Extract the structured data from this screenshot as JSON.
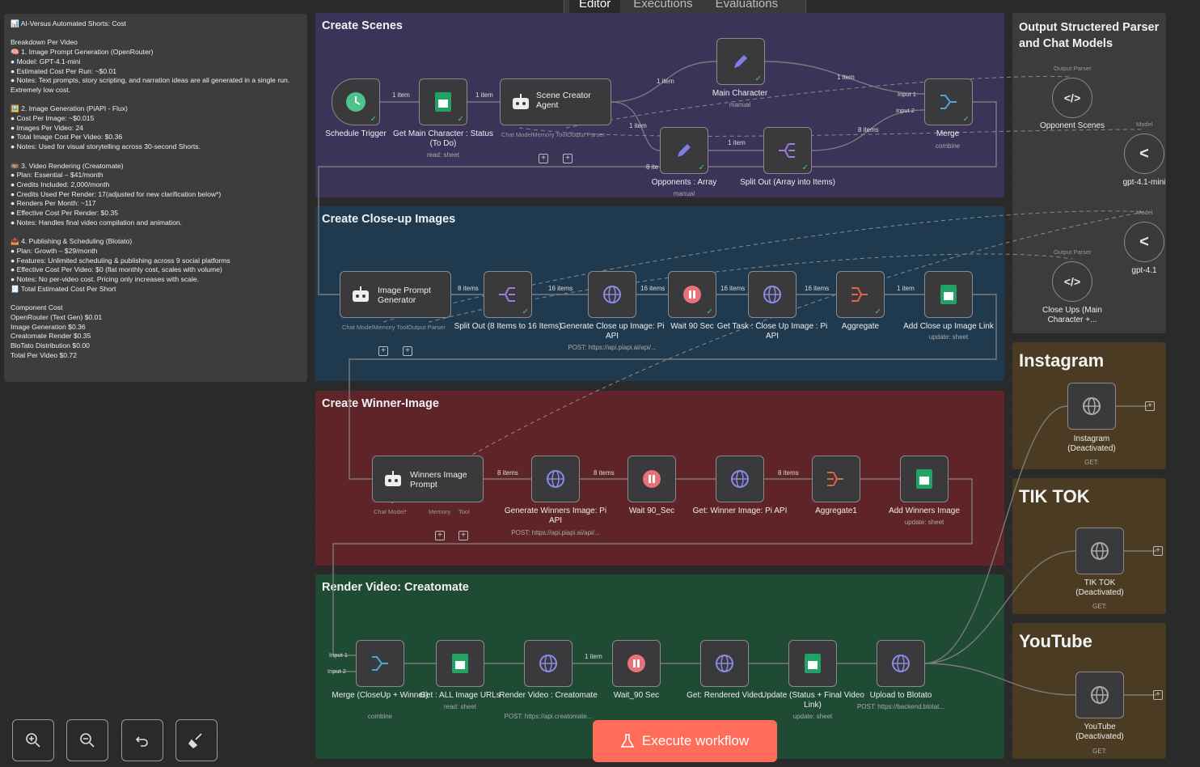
{
  "tabs": {
    "editor": "Editor",
    "executions": "Executions",
    "evaluations": "Evaluations"
  },
  "note": {
    "lines": [
      "📊 AI-Versus Automated Shorts: Cost",
      "",
      "Breakdown Per Video",
      "🧠 1. Image Prompt Generation (OpenRouter)",
      "● Model: GPT-4.1-mini",
      "● Estimated Cost Per Run: ~$0.01",
      "● Notes: Text prompts, story scripting, and narration ideas are all generated in a single run. Extremely low cost.",
      "",
      "🖼️ 2. Image Generation (PiAPI - Flux)",
      "● Cost Per Image: ~$0.015",
      "● Images Per Video: 24",
      "● Total Image Cost Per Video: $0.36",
      "● Notes: Used for visual storytelling across 30-second Shorts.",
      "",
      "🎞️ 3. Video Rendering (Creatomate)",
      "● Plan: Essential – $41/month",
      "● Credits Included: 2,000/month",
      "● Credits Used Per Render: 17(adjusted for new clarification below*)",
      "● Renders Per Month: ~117",
      "● Effective Cost Per Render: $0.35",
      "● Notes: Handles final video compilation and animation.",
      "",
      "📤 4. Publishing & Scheduling (Blotato)",
      "● Plan: Growth – $29/month",
      "● Features: Unlimited scheduling & publishing across 9 social platforms",
      "● Effective Cost Per Video: $0 (flat monthly cost, scales with volume)",
      "● Notes: No per-video cost. Pricing only increases with scale.",
      "🧾 Total Estimated Cost Per Short",
      "",
      "Component Cost",
      "OpenRouter (Text Gen) $0.01",
      "Image Generation $0.36",
      "Creatomate Render $0.35",
      "BloTato Distribution $0.00",
      "Total Per Video $0.72"
    ]
  },
  "sections": {
    "scenes": "Create Scenes",
    "closeup": "Create Close-up Images",
    "winner": "Create Winner-Image",
    "render": "Render Video: Creatomate",
    "parser": "Output Structered Parser and Chat Models",
    "instagram": "Instagram",
    "tiktok": "TIK TOK",
    "youtube": "YouTube"
  },
  "nodes": {
    "schedule": {
      "label": "Schedule Trigger"
    },
    "getMain": {
      "label": "Get Main Character : Status (To Do)",
      "sub": "read: sheet"
    },
    "sceneAgent": {
      "label": "Scene Creator Agent",
      "ports": "Chat ModelMemory   ToolOutput Parser"
    },
    "mainChar": {
      "label": "Main Character",
      "sub": "manual"
    },
    "merge": {
      "label": "Merge",
      "sub": "combine",
      "in1": "Input 1",
      "in2": "Input 2"
    },
    "opponents": {
      "label": "Opponents : Array",
      "sub": "manual"
    },
    "splitOut": {
      "label": "Split Out (Array into Items)"
    },
    "imgPrompt": {
      "label": "Image Prompt Generator",
      "ports": "Chat ModelMemory   ToolOutput Parser"
    },
    "split2": {
      "label": "Split Out (8 Items to 16 Items)"
    },
    "genClose": {
      "label": "Generate Close up Image: Pi API",
      "sub": "POST: https://api.piapi.ai/api/..."
    },
    "wait90": {
      "label": "Wait 90 Sec"
    },
    "getTask": {
      "label": "Get Task : Close Up Image : Pi API"
    },
    "aggregate": {
      "label": "Aggregate"
    },
    "addClose": {
      "label": "Add Close up Image Link",
      "sub": "update: sheet"
    },
    "winPrompt": {
      "label": "Winners Image Prompt",
      "p1": "Chat Model*",
      "p2": "Memory",
      "p3": "Tool"
    },
    "genWin": {
      "label": "Generate Winners Image: Pi API",
      "sub": "POST: https://api.piapi.ai/api/..."
    },
    "wait90b": {
      "label": "Wait 90_Sec"
    },
    "getWin": {
      "label": "Get: Winner Image: Pi API"
    },
    "aggregate1": {
      "label": "Aggregate1"
    },
    "addWin": {
      "label": "Add Winners Image",
      "sub": "update: sheet"
    },
    "mergeCU": {
      "label": "Merge (CloseUp + Winner)",
      "sub": "combine",
      "in1": "Input 1",
      "in2": "Input 2"
    },
    "getAll": {
      "label": "Get : ALL Image URLs",
      "sub": "read: sheet"
    },
    "renderVid": {
      "label": "Render Video : Creatomate",
      "sub": "POST: https://api.creatomate..."
    },
    "wait90c": {
      "label": "Wait_90 Sec"
    },
    "getRendered": {
      "label": "Get: Rendered Video"
    },
    "updateStatus": {
      "label": "Update (Status + Final Video Link)",
      "sub": "update: sheet"
    },
    "upload": {
      "label": "Upload to Blotato",
      "sub": "POST: https://backend.blotat..."
    },
    "oppScenes": {
      "label": "Opponent Scenes",
      "tag": "Output Parser"
    },
    "gpt41mini": {
      "label": "gpt-4.1-mini",
      "tag": "Model"
    },
    "gpt41": {
      "label": "gpt-4.1",
      "tag": "Model"
    },
    "closeUps": {
      "label": "Close Ups (Main Character +...",
      "tag": "Output Parser"
    },
    "insta": {
      "label": "Instagram (Deactivated)",
      "sub": "GET:"
    },
    "tiktok": {
      "label": "TIK TOK (Deactivated)",
      "sub": "GET:"
    },
    "youtube": {
      "label": "YouTube (Deactivated)",
      "sub": "GET:"
    }
  },
  "edges": {
    "one": "1 item",
    "eight": "8 items",
    "sixteen": "16 items",
    "eightTrunc": "8 ite"
  },
  "execute": "Execute workflow",
  "colors": {
    "scenes": "#3b3458",
    "closeup": "#1f3a4f",
    "winner": "#5e2428",
    "render": "#1f4a33",
    "parser": "#3c3c3e",
    "social": "#4a3b22",
    "accent": "#ff6d5a",
    "sheet": "#21a366",
    "wait": "#e8717a",
    "agent": "#7e7ee6"
  }
}
